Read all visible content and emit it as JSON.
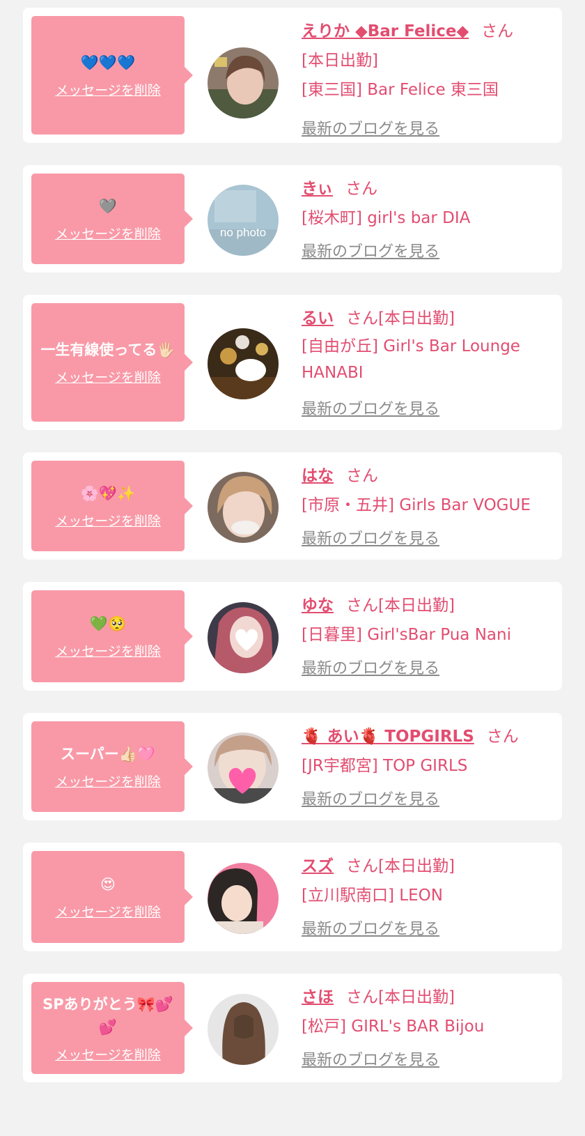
{
  "delete_label": "メッセージを削除",
  "blog_label": "最新のブログを見る",
  "san_label": "さん",
  "colors": {
    "page_bg": "#f2f2f2",
    "bubble_bg": "#f999a7",
    "link_pink": "#e24d70",
    "blog_gray": "#8a8a8a"
  },
  "messages": [
    {
      "message": "💙💙💙",
      "name": "えりか ◆Bar Felice◆",
      "status": "",
      "lines": [
        "[本日出勤]",
        "[東三国] Bar Felice 東三国"
      ],
      "avatar": "photo-selfie"
    },
    {
      "message": "🩶",
      "name": "きぃ",
      "status": "",
      "lines": [
        "[桜木町] girl's bar DIA"
      ],
      "avatar": "no-photo",
      "avatar_text": "no photo"
    },
    {
      "message": "一生有線使ってる🖐🏻",
      "name": "るい",
      "status": "[本日出勤]",
      "lines": [
        "[自由が丘] Girl's Bar Lounge HANABI"
      ],
      "avatar": "photo-dark-room"
    },
    {
      "message": "🌸💖✨",
      "name": "はな",
      "status": "",
      "lines": [
        "[市原・五井] Girls Bar VOGUE"
      ],
      "avatar": "photo-blonde"
    },
    {
      "message": "💚🥺",
      "name": "ゆな",
      "status": "[本日出勤]",
      "lines": [
        "[日暮里] Girl'sBar Pua Nani"
      ],
      "avatar": "photo-heart-face"
    },
    {
      "message": "スーパー👍🏻🩷",
      "name": "🫀 あい🫀 TOPGIRLS",
      "status": "",
      "lines": [
        "[JR宇都宮] TOP GIRLS"
      ],
      "avatar": "photo-pink-heart"
    },
    {
      "message": "😍",
      "name": "スズ",
      "status": "[本日出勤]",
      "lines": [
        "[立川駅南口] LEON"
      ],
      "avatar": "photo-pink-bg"
    },
    {
      "message": "SPありがとう🎀💕💕",
      "name": "さほ",
      "status": "[本日出勤]",
      "lines": [
        "[松戸] GIRL's BAR Bijou"
      ],
      "avatar": "photo-long-hair"
    }
  ]
}
